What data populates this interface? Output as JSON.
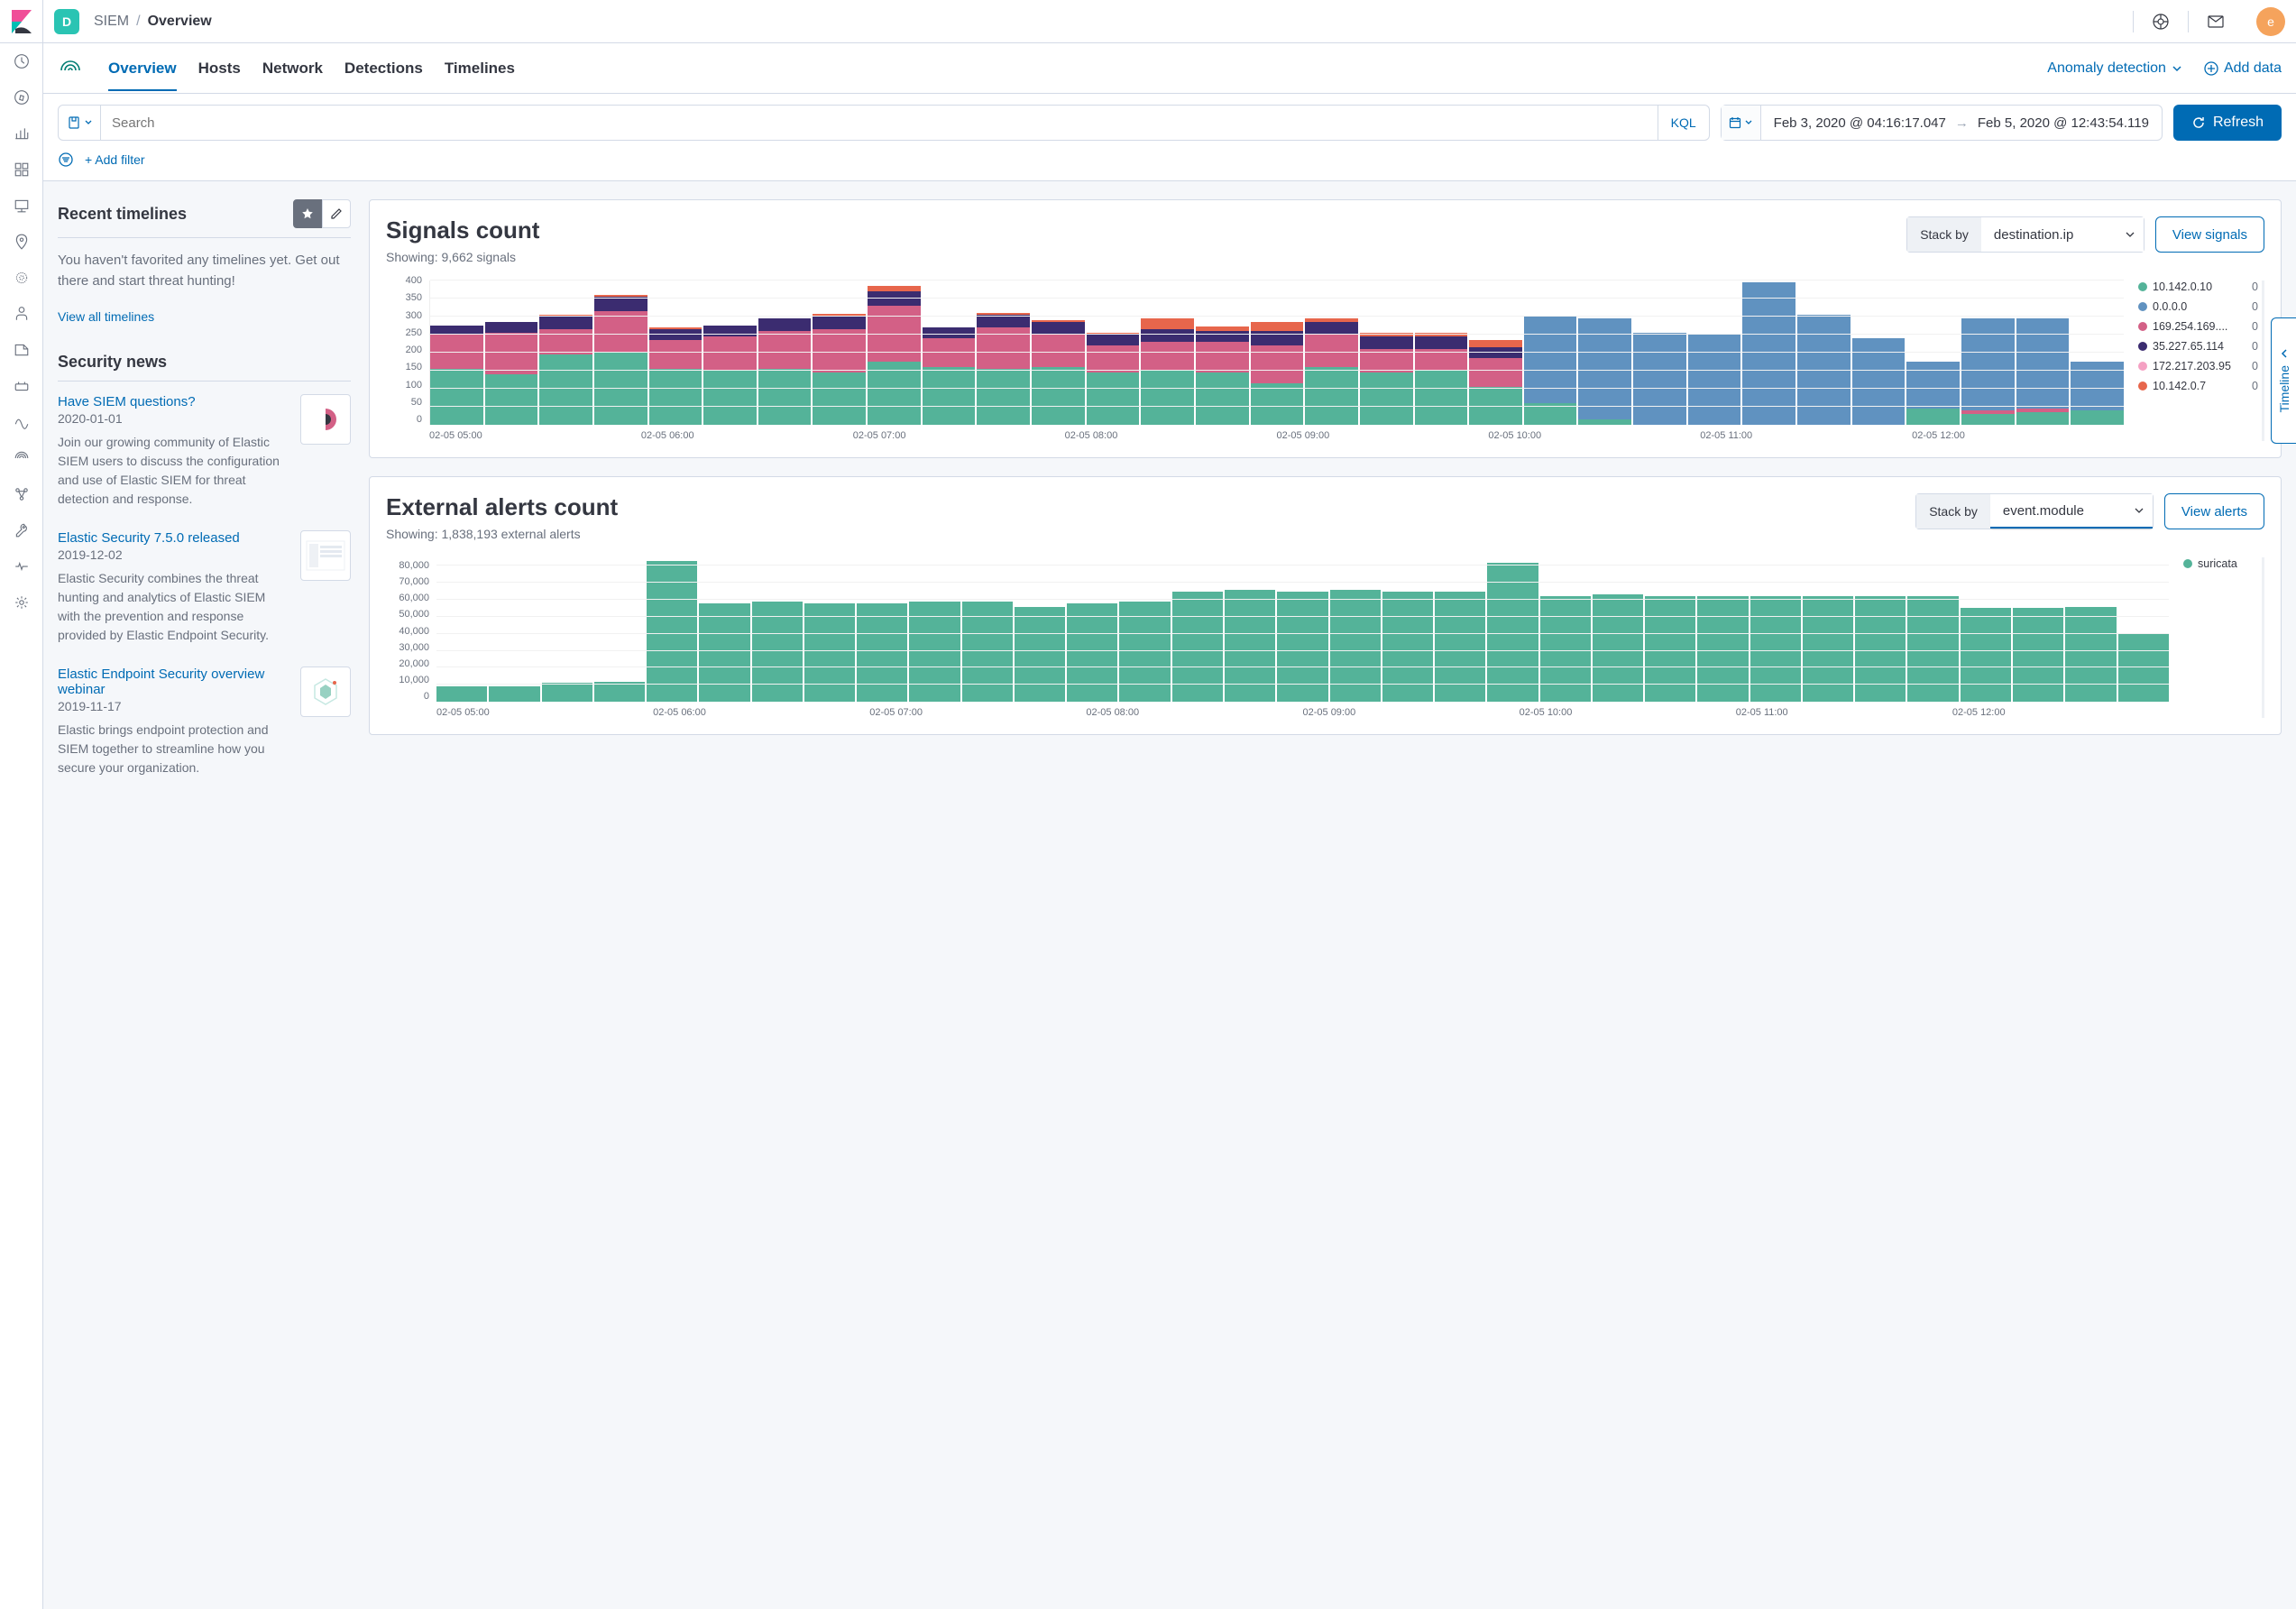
{
  "topbar": {
    "space_letter": "D",
    "breadcrumb": {
      "app": "SIEM",
      "page": "Overview"
    },
    "avatar_letter": "e"
  },
  "tabs": {
    "items": [
      "Overview",
      "Hosts",
      "Network",
      "Detections",
      "Timelines"
    ],
    "active": 0,
    "anomaly": "Anomaly detection",
    "add_data": "Add data"
  },
  "query": {
    "search_placeholder": "Search",
    "kql": "KQL",
    "date_start": "Feb 3, 2020 @ 04:16:17.047",
    "date_end": "Feb 5, 2020 @ 12:43:54.119",
    "refresh": "Refresh",
    "add_filter": "+ Add filter"
  },
  "sidebar": {
    "timelines_title": "Recent timelines",
    "timelines_empty": "You haven't favorited any timelines yet. Get out there and start threat hunting!",
    "view_all": "View all timelines",
    "news_title": "Security news",
    "news": [
      {
        "title": "Have SIEM questions?",
        "date": "2020-01-01",
        "desc": "Join our growing community of Elastic SIEM users to discuss the configuration and use of Elastic SIEM for threat detection and response."
      },
      {
        "title": "Elastic Security 7.5.0 released",
        "date": "2019-12-02",
        "desc": "Elastic Security combines the threat hunting and analytics of Elastic SIEM with the prevention and response provided by Elastic Endpoint Security."
      },
      {
        "title": "Elastic Endpoint Security overview webinar",
        "date": "2019-11-17",
        "desc": "Elastic brings endpoint protection and SIEM together to streamline how you secure your organization."
      }
    ]
  },
  "signals": {
    "title": "Signals count",
    "showing": "Showing: 9,662 signals",
    "stack_by_label": "Stack by",
    "stack_by_value": "destination.ip",
    "view_btn": "View signals",
    "legend": [
      {
        "name": "10.142.0.10",
        "color": "#54b399",
        "value": "0"
      },
      {
        "name": "0.0.0.0",
        "color": "#6092c0",
        "value": "0"
      },
      {
        "name": "169.254.169....",
        "color": "#d36086",
        "value": "0"
      },
      {
        "name": "35.227.65.114",
        "color": "#3b2c70",
        "value": "0"
      },
      {
        "name": "172.217.203.95",
        "color": "#f5a1c3",
        "value": "0"
      },
      {
        "name": "10.142.0.7",
        "color": "#e7664c",
        "value": "0"
      }
    ]
  },
  "alerts": {
    "title": "External alerts count",
    "showing": "Showing: 1,838,193 external alerts",
    "stack_by_label": "Stack by",
    "stack_by_value": "event.module",
    "view_btn": "View alerts",
    "legend": [
      {
        "name": "suricata",
        "color": "#54b399"
      }
    ]
  },
  "flyout": {
    "label": "Timeline"
  },
  "chart_data": [
    {
      "type": "bar",
      "stacked": true,
      "title": "Signals count",
      "ylabel": "",
      "ylim": [
        0,
        400
      ],
      "y_ticks": [
        0,
        50,
        100,
        150,
        200,
        250,
        300,
        350,
        400
      ],
      "x_ticks": [
        "02-05 05:00",
        "02-05 06:00",
        "02-05 07:00",
        "02-05 08:00",
        "02-05 09:00",
        "02-05 10:00",
        "02-05 11:00",
        "02-05 12:00"
      ],
      "colors": {
        "10.142.0.10": "#54b399",
        "0.0.0.0": "#6092c0",
        "169.254.169.254": "#d36086",
        "35.227.65.114": "#3b2c70",
        "other": "#e7664c"
      },
      "bars": [
        {
          "segments": [
            {
              "k": "10.142.0.10",
              "v": 155
            },
            {
              "k": "169.254.169.254",
              "v": 95
            },
            {
              "k": "35.227.65.114",
              "v": 25
            }
          ]
        },
        {
          "segments": [
            {
              "k": "10.142.0.10",
              "v": 140
            },
            {
              "k": "169.254.169.254",
              "v": 115
            },
            {
              "k": "35.227.65.114",
              "v": 30
            }
          ]
        },
        {
          "segments": [
            {
              "k": "10.142.0.10",
              "v": 195
            },
            {
              "k": "169.254.169.254",
              "v": 70
            },
            {
              "k": "35.227.65.114",
              "v": 35
            },
            {
              "k": "other",
              "v": 6
            }
          ]
        },
        {
          "segments": [
            {
              "k": "10.142.0.10",
              "v": 200
            },
            {
              "k": "169.254.169.254",
              "v": 115
            },
            {
              "k": "35.227.65.114",
              "v": 40
            },
            {
              "k": "other",
              "v": 6
            }
          ]
        },
        {
          "segments": [
            {
              "k": "10.142.0.10",
              "v": 155
            },
            {
              "k": "169.254.169.254",
              "v": 80
            },
            {
              "k": "35.227.65.114",
              "v": 30
            },
            {
              "k": "other",
              "v": 6
            }
          ]
        },
        {
          "segments": [
            {
              "k": "10.142.0.10",
              "v": 150
            },
            {
              "k": "169.254.169.254",
              "v": 95
            },
            {
              "k": "35.227.65.114",
              "v": 30
            }
          ]
        },
        {
          "segments": [
            {
              "k": "10.142.0.10",
              "v": 155
            },
            {
              "k": "169.254.169.254",
              "v": 105
            },
            {
              "k": "35.227.65.114",
              "v": 35
            }
          ]
        },
        {
          "segments": [
            {
              "k": "10.142.0.10",
              "v": 145
            },
            {
              "k": "169.254.169.254",
              "v": 120
            },
            {
              "k": "35.227.65.114",
              "v": 35
            },
            {
              "k": "other",
              "v": 8
            }
          ]
        },
        {
          "segments": [
            {
              "k": "10.142.0.10",
              "v": 175
            },
            {
              "k": "169.254.169.254",
              "v": 155
            },
            {
              "k": "35.227.65.114",
              "v": 40
            },
            {
              "k": "other",
              "v": 15
            }
          ]
        },
        {
          "segments": [
            {
              "k": "10.142.0.10",
              "v": 160
            },
            {
              "k": "169.254.169.254",
              "v": 80
            },
            {
              "k": "35.227.65.114",
              "v": 30
            }
          ]
        },
        {
          "segments": [
            {
              "k": "10.142.0.10",
              "v": 155
            },
            {
              "k": "169.254.169.254",
              "v": 115
            },
            {
              "k": "35.227.65.114",
              "v": 35
            },
            {
              "k": "other",
              "v": 6
            }
          ]
        },
        {
          "segments": [
            {
              "k": "10.142.0.10",
              "v": 160
            },
            {
              "k": "169.254.169.254",
              "v": 90
            },
            {
              "k": "35.227.65.114",
              "v": 35
            },
            {
              "k": "other",
              "v": 6
            }
          ]
        },
        {
          "segments": [
            {
              "k": "10.142.0.10",
              "v": 145
            },
            {
              "k": "169.254.169.254",
              "v": 75
            },
            {
              "k": "35.227.65.114",
              "v": 30
            },
            {
              "k": "other",
              "v": 6
            }
          ]
        },
        {
          "segments": [
            {
              "k": "10.142.0.10",
              "v": 150
            },
            {
              "k": "169.254.169.254",
              "v": 80
            },
            {
              "k": "35.227.65.114",
              "v": 35
            },
            {
              "k": "other",
              "v": 30
            }
          ]
        },
        {
          "segments": [
            {
              "k": "10.142.0.10",
              "v": 145
            },
            {
              "k": "169.254.169.254",
              "v": 85
            },
            {
              "k": "35.227.65.114",
              "v": 30
            },
            {
              "k": "other",
              "v": 12
            }
          ]
        },
        {
          "segments": [
            {
              "k": "10.142.0.10",
              "v": 115
            },
            {
              "k": "169.254.169.254",
              "v": 105
            },
            {
              "k": "35.227.65.114",
              "v": 40
            },
            {
              "k": "other",
              "v": 25
            }
          ]
        },
        {
          "segments": [
            {
              "k": "10.142.0.10",
              "v": 160
            },
            {
              "k": "169.254.169.254",
              "v": 90
            },
            {
              "k": "35.227.65.114",
              "v": 35
            },
            {
              "k": "other",
              "v": 10
            }
          ]
        },
        {
          "segments": [
            {
              "k": "10.142.0.10",
              "v": 145
            },
            {
              "k": "169.254.169.254",
              "v": 65
            },
            {
              "k": "35.227.65.114",
              "v": 35
            },
            {
              "k": "other",
              "v": 10
            }
          ]
        },
        {
          "segments": [
            {
              "k": "10.142.0.10",
              "v": 150
            },
            {
              "k": "169.254.169.254",
              "v": 60
            },
            {
              "k": "35.227.65.114",
              "v": 35
            },
            {
              "k": "other",
              "v": 10
            }
          ]
        },
        {
          "segments": [
            {
              "k": "10.142.0.10",
              "v": 105
            },
            {
              "k": "169.254.169.254",
              "v": 80
            },
            {
              "k": "35.227.65.114",
              "v": 30
            },
            {
              "k": "other",
              "v": 20
            }
          ]
        },
        {
          "segments": [
            {
              "k": "10.142.0.10",
              "v": 60
            },
            {
              "k": "0.0.0.0",
              "v": 240
            }
          ]
        },
        {
          "segments": [
            {
              "k": "10.142.0.10",
              "v": 15
            },
            {
              "k": "0.0.0.0",
              "v": 280
            }
          ]
        },
        {
          "segments": [
            {
              "k": "0.0.0.0",
              "v": 255
            }
          ]
        },
        {
          "segments": [
            {
              "k": "0.0.0.0",
              "v": 250
            }
          ]
        },
        {
          "segments": [
            {
              "k": "0.0.0.0",
              "v": 395
            }
          ]
        },
        {
          "segments": [
            {
              "k": "0.0.0.0",
              "v": 305
            }
          ]
        },
        {
          "segments": [
            {
              "k": "0.0.0.0",
              "v": 240
            }
          ]
        },
        {
          "segments": [
            {
              "k": "10.142.0.10",
              "v": 45
            },
            {
              "k": "0.0.0.0",
              "v": 130
            }
          ]
        },
        {
          "segments": [
            {
              "k": "10.142.0.10",
              "v": 30
            },
            {
              "k": "169.254.169.254",
              "v": 10
            },
            {
              "k": "0.0.0.0",
              "v": 255
            }
          ]
        },
        {
          "segments": [
            {
              "k": "10.142.0.10",
              "v": 35
            },
            {
              "k": "169.254.169.254",
              "v": 10
            },
            {
              "k": "0.0.0.0",
              "v": 250
            }
          ]
        },
        {
          "segments": [
            {
              "k": "10.142.0.10",
              "v": 40
            },
            {
              "k": "0.0.0.0",
              "v": 135
            }
          ]
        }
      ]
    },
    {
      "type": "bar",
      "title": "External alerts count",
      "ylabel": "",
      "ylim": [
        0,
        85000
      ],
      "y_ticks": [
        0,
        10000,
        20000,
        30000,
        40000,
        50000,
        60000,
        70000,
        80000
      ],
      "x_ticks": [
        "02-05 05:00",
        "02-05 06:00",
        "02-05 07:00",
        "02-05 08:00",
        "02-05 09:00",
        "02-05 10:00",
        "02-05 11:00",
        "02-05 12:00"
      ],
      "series": [
        {
          "name": "suricata",
          "color": "#54b399"
        }
      ],
      "values": [
        9000,
        9000,
        11000,
        11500,
        83000,
        58000,
        59000,
        58000,
        58000,
        59000,
        59000,
        56000,
        58000,
        59000,
        65000,
        66000,
        65000,
        66000,
        65000,
        65000,
        82000,
        62000,
        63000,
        62000,
        62000,
        62000,
        62000,
        62000,
        62000,
        55000,
        55000,
        56000,
        40000
      ]
    }
  ]
}
